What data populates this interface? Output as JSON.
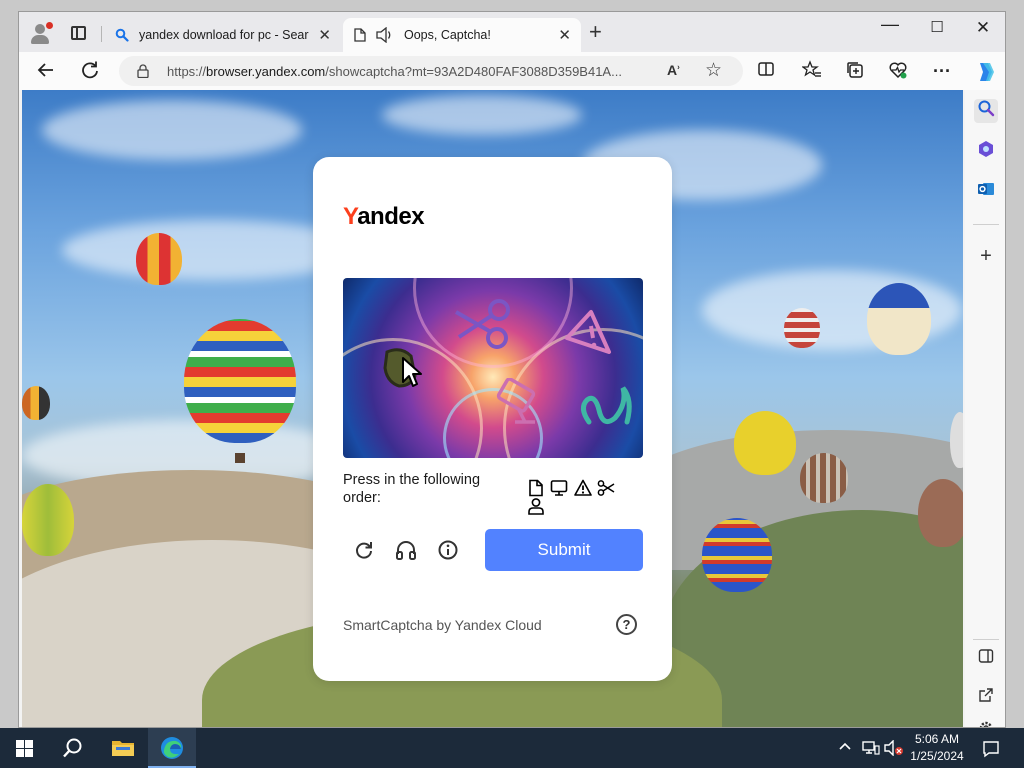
{
  "browser": {
    "tabs": [
      {
        "title": "yandex download for pc - Search",
        "active": false
      },
      {
        "title": "Oops, Captcha!",
        "active": true
      }
    ],
    "address": {
      "url_prefix": "https://",
      "url_host": "browser.yandex.com",
      "url_rest": "/showcaptcha?mt=93A2D480FAF3088D359B41A..."
    }
  },
  "captcha": {
    "brand": {
      "first_letter": "Y",
      "rest": "andex"
    },
    "instruction": "Press in the following order:",
    "order_icons": [
      "document-icon",
      "monitor-icon",
      "warning-icon",
      "scissors-icon",
      "person-icon"
    ],
    "submit_label": "Submit",
    "footer": "SmartCaptcha by Yandex Cloud",
    "help_symbol": "?",
    "colors": {
      "submit": "#5282ff",
      "brand_accent": "#fc3f1d"
    }
  },
  "taskbar": {
    "time": "5:06 AM",
    "date": "1/25/2024"
  }
}
